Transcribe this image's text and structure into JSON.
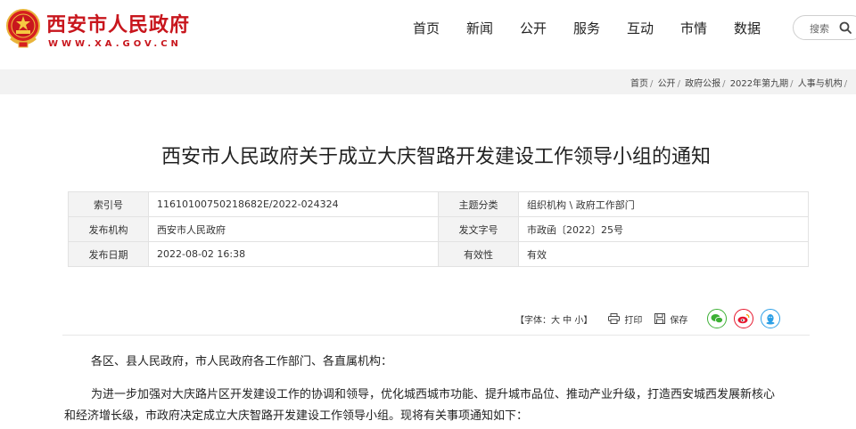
{
  "brand": {
    "name_cn": "西安市人民政府",
    "name_en": "WWW.XA.GOV.CN"
  },
  "nav": [
    "首页",
    "新闻",
    "公开",
    "服务",
    "互动",
    "市情",
    "数据"
  ],
  "search": {
    "label": "搜索"
  },
  "breadcrumb": [
    "首页",
    "公开",
    "政府公报",
    "2022年第九期",
    "人事与机构",
    "/"
  ],
  "title": "西安市人民政府关于成立大庆智路开发建设工作领导小组的通知",
  "meta": {
    "index_label": "索引号",
    "index_value": "11610100750218682E/2022-024324",
    "topic_label": "主题分类",
    "topic_value": "组织机构 \\ 政府工作部门",
    "issuer_label": "发布机构",
    "issuer_value": "西安市人民政府",
    "docno_label": "发文字号",
    "docno_value": "市政函〔2022〕25号",
    "date_label": "发布日期",
    "date_value": "2022-08-02 16:38",
    "validity_label": "有效性",
    "validity_value": "有效"
  },
  "tools": {
    "font_size": "【字体：大 中 小】",
    "print": "打印",
    "save": "保存"
  },
  "share_icons": [
    "wechat-icon",
    "weibo-icon",
    "qq-icon"
  ],
  "colors": {
    "brand_red": "#c8161d",
    "wechat": "#3cb034",
    "weibo": "#e6162d",
    "qq": "#2b9fe6"
  },
  "body": {
    "salutation": "各区、县人民政府，市人民政府各工作部门、各直属机构：",
    "para1_line1": "为进一步加强对大庆路片区开发建设工作的协调和领导，优化城西城市功能、提升城市品位、推动产业升级，打造西安城西发展新核心",
    "para1_line2": "和经济增长级，市政府决定成立大庆智路开发建设工作领导小组。现将有关事项通知如下："
  }
}
